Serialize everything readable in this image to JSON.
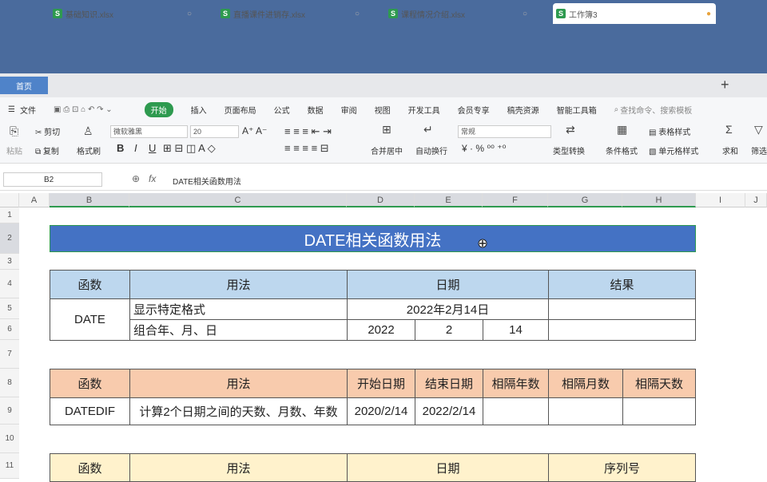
{
  "tabs": {
    "home": "首页",
    "items": [
      {
        "label": "基础知识.xlsx"
      },
      {
        "label": "直播课件进销存.xlsx"
      },
      {
        "label": "课程情况介绍.xlsx"
      },
      {
        "label": "工作簿3"
      }
    ],
    "new_tab": "+"
  },
  "menu": {
    "file": "文件",
    "items": [
      "开始",
      "插入",
      "页面布局",
      "公式",
      "数据",
      "审阅",
      "视图",
      "开发工具",
      "会员专享",
      "稿壳资源",
      "智能工具箱"
    ],
    "search": "查找命令、搜索模板"
  },
  "ribbon": {
    "paste": "粘贴",
    "cut": "剪切",
    "copy": "复制",
    "format_painter": "格式刷",
    "font": "微软雅黑",
    "size": "20",
    "merge": "合并居中",
    "wrap": "自动换行",
    "number_format": "常规",
    "type_convert": "类型转换",
    "cond_format": "条件格式",
    "table_style": "表格样式",
    "cell_style": "单元格样式",
    "sum": "求和",
    "filter": "筛选",
    "bold": "B",
    "italic": "I",
    "underline": "U"
  },
  "formula_bar": {
    "cell_ref": "B2",
    "fx": "fx",
    "content": "DATE相关函数用法"
  },
  "columns": [
    "A",
    "B",
    "C",
    "D",
    "E",
    "F",
    "G",
    "H",
    "I",
    "J"
  ],
  "rows": [
    "1",
    "2",
    "3",
    "4",
    "5",
    "6",
    "7",
    "8",
    "9",
    "10",
    "11"
  ],
  "sheet": {
    "title": "DATE相关函数用法",
    "t1": {
      "headers": [
        "函数",
        "用法",
        "日期",
        "结果"
      ],
      "func": "DATE",
      "r5_usage": "显示特定格式",
      "r5_date": "2022年2月14日",
      "r6_usage": "组合年、月、日",
      "r6_year": "2022",
      "r6_month": "2",
      "r6_day": "14"
    },
    "t2": {
      "headers": [
        "函数",
        "用法",
        "开始日期",
        "结束日期",
        "相隔年数",
        "相隔月数",
        "相隔天数"
      ],
      "func": "DATEDIF",
      "usage": "计算2个日期之间的天数、月数、年数",
      "start": "2020/2/14",
      "end": "2022/2/14"
    },
    "t3": {
      "headers": [
        "函数",
        "用法",
        "日期",
        "序列号"
      ]
    }
  },
  "colors": {
    "title_bg": "#4472c4",
    "t1_header": "#bdd7ee",
    "t2_header": "#f8cbad",
    "t3_header": "#fff2cc",
    "accent": "#2e9a4f"
  }
}
